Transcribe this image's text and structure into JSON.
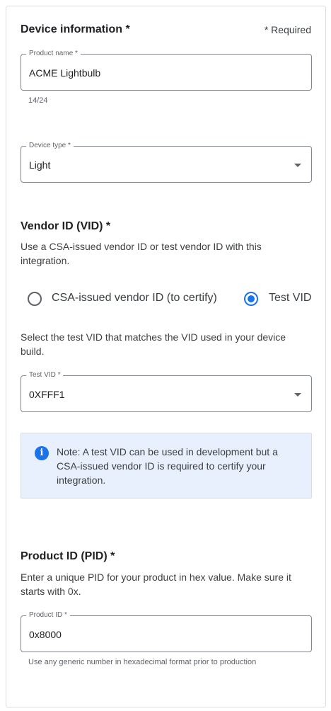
{
  "device_info": {
    "title": "Device information *",
    "required_note": "* Required"
  },
  "product_name": {
    "label": "Product name *",
    "value": "ACME Lightbulb",
    "counter": "14/24"
  },
  "device_type": {
    "label": "Device type *",
    "value": "Light"
  },
  "vendor": {
    "title": "Vendor ID (VID) *",
    "description": "Use a CSA-issued vendor ID or test vendor ID with this integration.",
    "options": [
      {
        "label": "CSA-issued vendor ID (to certify)",
        "selected": false
      },
      {
        "label": "Test VID",
        "selected": true
      }
    ],
    "test_vid_instruction": "Select the test VID that matches the VID used in your device build."
  },
  "test_vid": {
    "label": "Test VID *",
    "value": "0XFFF1"
  },
  "note": {
    "icon": "info-icon",
    "text": "Note: A test VID can be used in development but a CSA-issued vendor ID is required to certify your integration."
  },
  "product_id_section": {
    "title": "Product ID (PID) *",
    "description": "Enter a unique PID for your product in hex value. Make sure it starts with 0x."
  },
  "product_id": {
    "label": "Product ID *",
    "value": "0x8000",
    "hint": "Use any generic number in hexadecimal format prior to production"
  },
  "colors": {
    "accent": "#1a73e8",
    "note_background": "#e8f0fe"
  }
}
